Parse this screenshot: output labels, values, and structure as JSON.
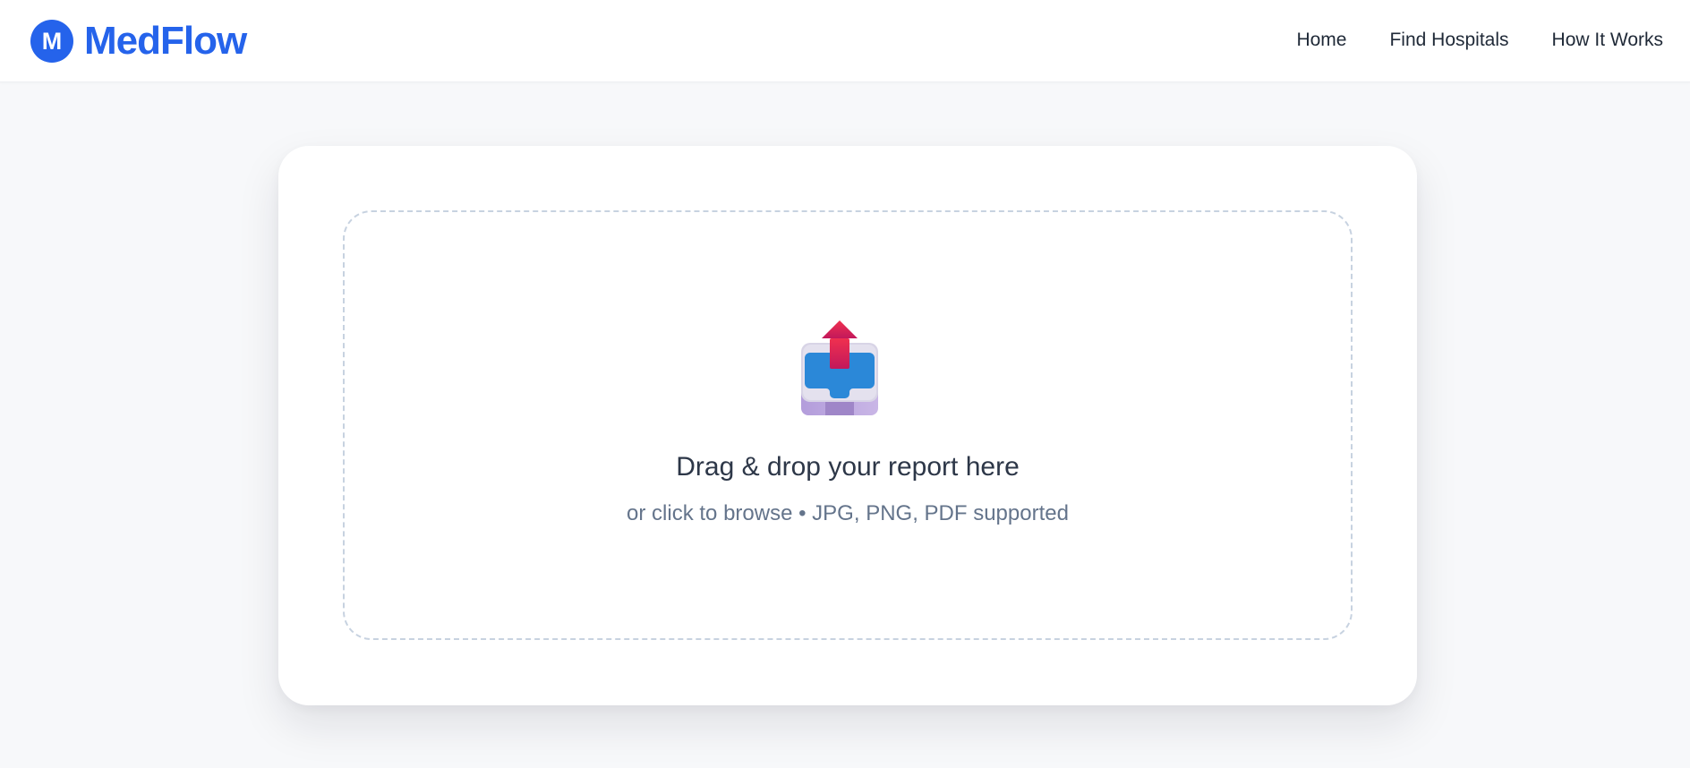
{
  "header": {
    "logo_letter": "M",
    "brand_name": "MedFlow",
    "nav": [
      {
        "label": "Home"
      },
      {
        "label": "Find Hospitals"
      },
      {
        "label": "How It Works"
      }
    ]
  },
  "upload": {
    "title": "Drag & drop your report here",
    "subtitle": "or click to browse • JPG, PNG, PDF supported",
    "icon": "upload-tray-icon"
  },
  "colors": {
    "brand": "#2563eb",
    "page_bg": "#f7f8fa",
    "dropzone_border": "#c7d2e0",
    "arrow": "#e11d48",
    "tray_blue": "#2b88d8"
  }
}
